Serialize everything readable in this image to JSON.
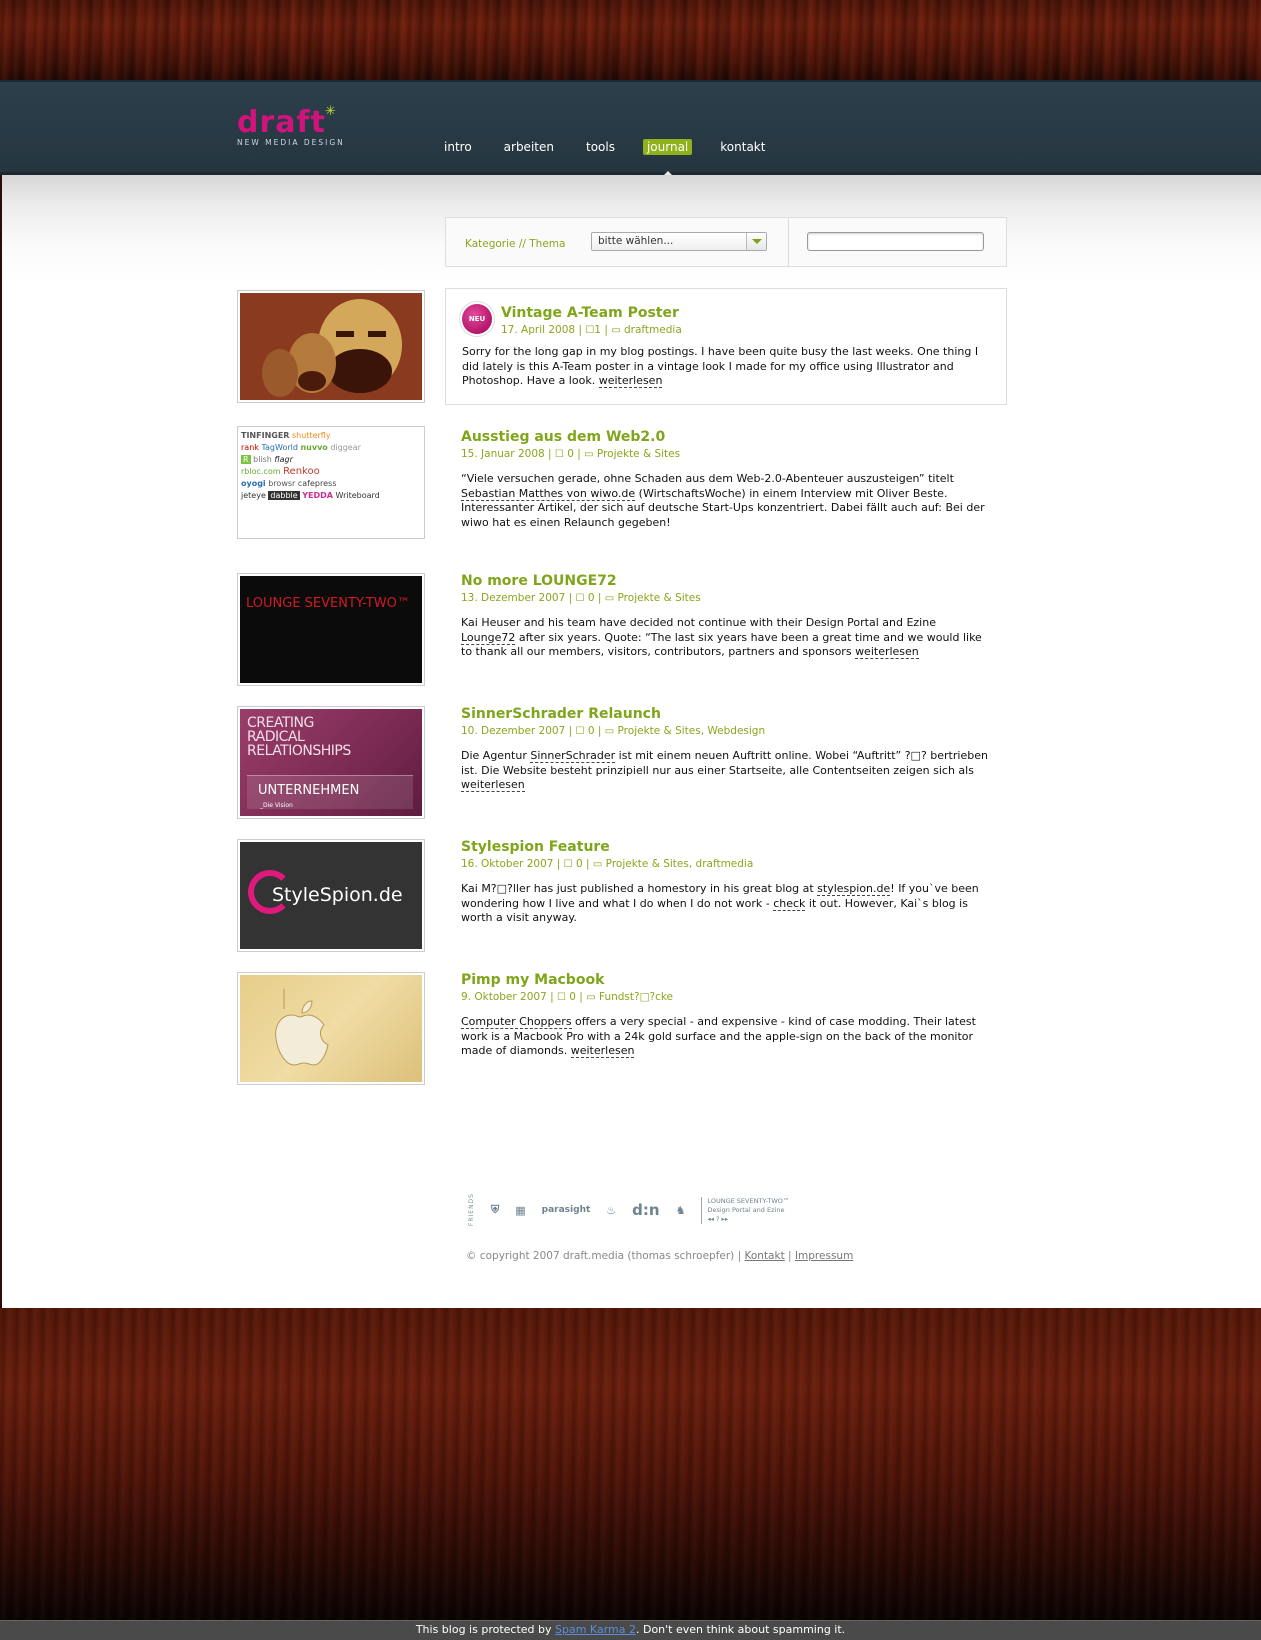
{
  "logo": {
    "word": "draft",
    "spark": "✳",
    "sub": "NEW MEDIA DESIGN"
  },
  "nav": [
    {
      "label": "intro",
      "active": false
    },
    {
      "label": "arbeiten",
      "active": false
    },
    {
      "label": "tools",
      "active": false
    },
    {
      "label": "journal",
      "active": true
    },
    {
      "label": "kontakt",
      "active": false
    }
  ],
  "filter": {
    "label": "Kategorie // Thema",
    "select_value": "bitte wählen...",
    "search_value": ""
  },
  "colors": {
    "accent": "#7fa51a",
    "brand": "#d1147b",
    "header": "#2c3f4c"
  },
  "posts": [
    {
      "title": "Vintage A-Team Poster",
      "date": "17. April 2008",
      "comments": "1",
      "categories": "draftmedia",
      "badge": "NEU",
      "excerpt_before": "Sorry for the long gap in my blog postings. I have been quite busy the last weeks. One thing I did lately is this A-Team poster in a vintage look I made for my office using Illustrator and Photoshop. Have a look.",
      "link": "weiterlesen",
      "thumb_icon": "a-team-poster-image"
    },
    {
      "title": "Ausstieg aus dem Web2.0",
      "date": "15. Januar 2008",
      "comments": "0",
      "categories": "Projekte & Sites",
      "excerpt_a": " “Viele versuchen gerade, ohne Schaden aus dem Web-2.0-Abenteuer auszusteigen”  titelt",
      "link": "Sebastian Matthes von wiwo.de",
      "excerpt_b": " (WirtschaftsWoche) in einem Interview mit Oliver Beste. Interessanter Artikel, der sich auf deutsche Start-Ups konzentriert. Dabei fällt auch auf: Bei der wiwo hat es einen Relaunch gegeben!",
      "logos": [
        "TINFINGER",
        "shutterfly",
        "rank",
        "TagWorld",
        "nuvvo",
        "diggear",
        "R",
        "blish",
        "flagr",
        "rbloc.com",
        "Renkoo",
        "oyogi",
        "browsr",
        "cafepress",
        "jeteye",
        "dabble",
        "YEDDA",
        "Writeboard"
      ]
    },
    {
      "title": "No more LOUNGE72",
      "date": "13. Dezember 2007",
      "comments": "0",
      "categories": "Projekte & Sites",
      "excerpt_a": "Kai Heuser and his team have decided not continue with their Design Portal and Ezine ",
      "link": "Lounge72",
      "excerpt_b": " after six years. Quote:  “The last six years have been a great time and we would like to thank all our members, visitors, contributors, partners and sponsors ",
      "link2": "weiterlesen",
      "thumb_text": "LOUNGE SEVENTY-TWO™"
    },
    {
      "title": "SinnerSchrader Relaunch",
      "date": "10. Dezember 2007",
      "comments": "0",
      "categories": "Projekte & Sites, Webdesign",
      "excerpt_a": "Die Agentur ",
      "link": "SinnerSchrader",
      "excerpt_b": " ist mit einem neuen Auftritt online. Wobei  “Auftritt”  ?□? bertrieben ist. Die Website besteht prinzipiell nur aus einer Startseite, alle Contentseiten zeigen sich als ",
      "link2": "weiterlesen",
      "thumb_lines": [
        "CREATING",
        "RADICAL",
        "RELATIONSHIPS"
      ],
      "thumb_sub": "UNTERNEHMEN",
      "thumb_sub2": "_Die Vision"
    },
    {
      "title": "Stylespion Feature",
      "date": "16. Oktober 2007",
      "comments": "0",
      "categories": "Projekte & Sites, draftmedia",
      "excerpt_a": "Kai M?□?ller has just published a homestory in his great blog at ",
      "link": "stylespion.de",
      "excerpt_b": "! If you`ve been wondering how I live and what I do when I do not work - ",
      "link2": "check",
      "excerpt_c": " it out. However, Kai`s blog is worth a visit anyway.",
      "thumb_text": "StyleSpion.de"
    },
    {
      "title": "Pimp my Macbook",
      "date": "9. Oktober 2007",
      "comments": "0",
      "categories": "Fundst?□?cke",
      "link": "Computer Choppers",
      "excerpt_b": " offers a very special - and expensive - kind of case modding. Their latest work is a Macbook Pro with a 24k gold surface and the apple-sign on the back of the monitor made of diamonds. ",
      "link2": "weiterlesen",
      "thumb_icon": "apple-logo"
    }
  ],
  "friends": {
    "label": "FRIENDS",
    "items": [
      "parasight",
      "d:n"
    ],
    "lounge_line1": "LOUNGE SEVENTY-TWO™",
    "lounge_line2": "Design Portal and Ezine",
    "lounge_line3": "◂◂   ?   ▸▸"
  },
  "footer": {
    "copyright": "© copyright 2007 draft.media (thomas schroepfer) |",
    "kontakt": "Kontakt",
    "sep": "|",
    "impressum": "Impressum"
  },
  "spam": {
    "before": "This blog is protected by ",
    "link": "Spam Karma 2",
    "after": ". Don't even think about spamming it."
  }
}
